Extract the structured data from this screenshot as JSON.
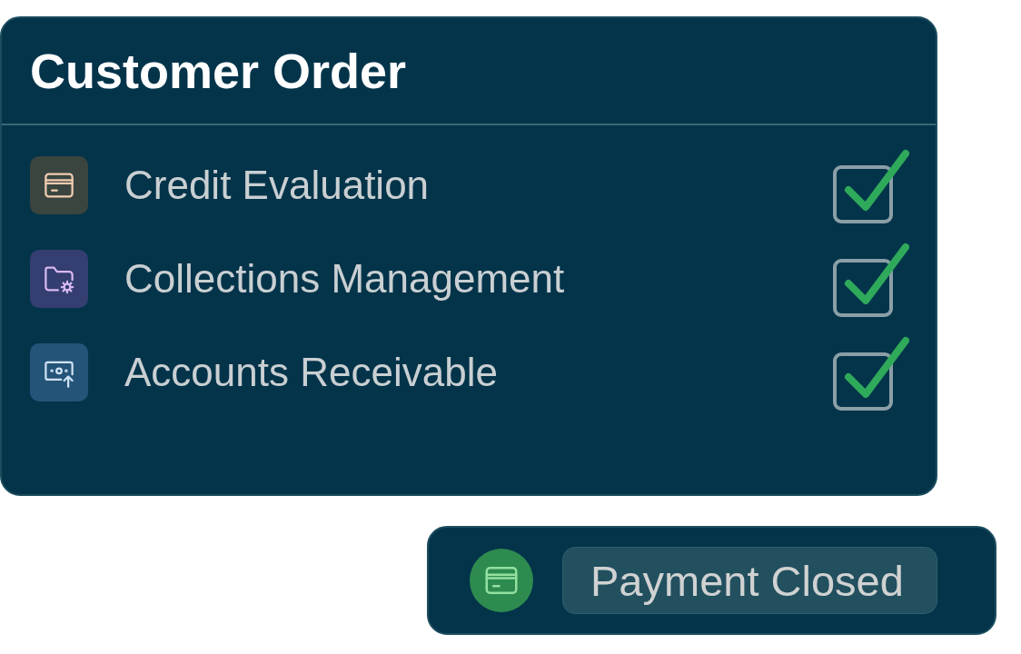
{
  "card": {
    "title": "Customer Order",
    "items": [
      {
        "label": "Credit Evaluation",
        "color": "#3a453f",
        "checked": true
      },
      {
        "label": "Collections Management",
        "color": "#343e70",
        "checked": true
      },
      {
        "label": "Accounts Receivable",
        "color": "#245478",
        "checked": true
      }
    ]
  },
  "status_pill": {
    "label": "Payment Closed",
    "color": "#2e8b4f"
  }
}
